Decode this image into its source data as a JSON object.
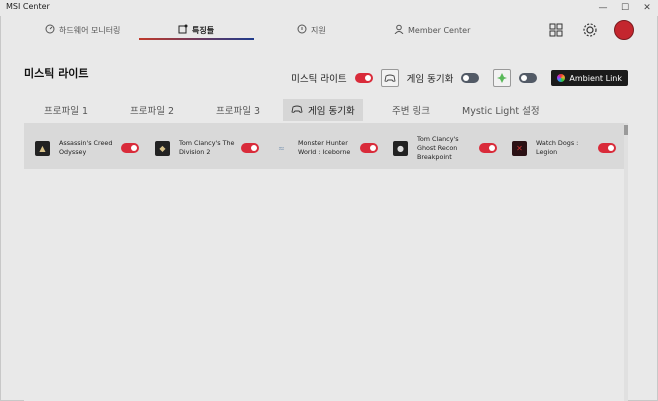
{
  "window": {
    "title": "MSI Center",
    "minimize_icon": "—",
    "maximize_icon": "☐",
    "close_icon": "✕"
  },
  "nav": {
    "items": [
      {
        "label": "하드웨어 모니터링",
        "icon": "gauge-icon"
      },
      {
        "label": "특징들",
        "icon": "features-icon"
      },
      {
        "label": "지원",
        "icon": "support-icon"
      },
      {
        "label": "Member Center",
        "icon": "user-icon"
      }
    ],
    "active_index": 1
  },
  "page": {
    "title": "미스틱 라이트"
  },
  "controls": {
    "mystic_light_label": "미스틱 라이트",
    "mystic_light_on": true,
    "game_sync_label": "게임 동기화",
    "game_sync_on": false,
    "razer_on": false,
    "ambient_link_label": "Ambient Link"
  },
  "tabs": [
    {
      "label": "프로파일 1"
    },
    {
      "label": "프로파일 2"
    },
    {
      "label": "프로파일 3"
    },
    {
      "label": "게임 동기화",
      "active": true
    },
    {
      "label": "주변 링크"
    },
    {
      "label": "Mystic Light 설정"
    }
  ],
  "games": [
    {
      "name": "Assassin's Creed Odyssey",
      "enabled": true
    },
    {
      "name": "Tom Clancy's The Division 2",
      "enabled": true
    },
    {
      "name": "Monster Hunter World : Iceborne",
      "enabled": true
    },
    {
      "name": "Tom Clancy's Ghost Recon Breakpoint",
      "enabled": true
    },
    {
      "name": "Watch Dogs : Legion",
      "enabled": true
    }
  ],
  "colors": {
    "toggle_on": "#d92b3a",
    "toggle_off": "#525a66",
    "accent_red": "#c0392b",
    "accent_blue": "#1f3b8c"
  }
}
